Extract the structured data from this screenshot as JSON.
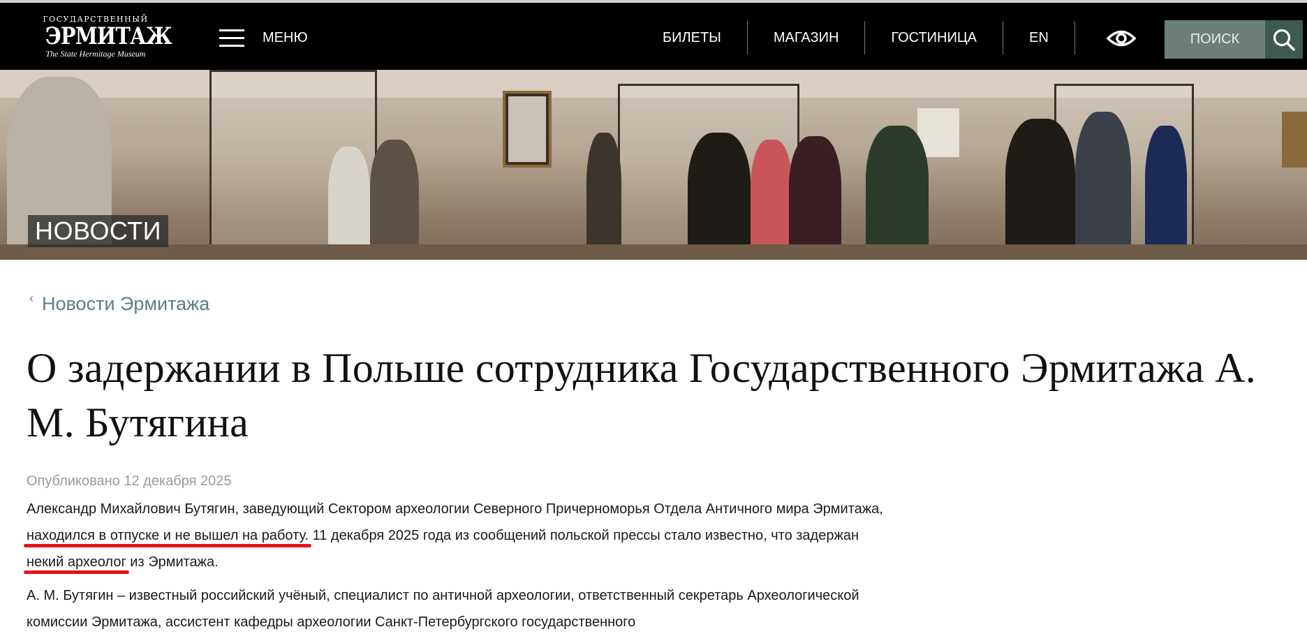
{
  "header": {
    "logo_line1": "ГОСУДАРСТВЕННЫЙ",
    "logo_line2": "ЭРМИТАЖ",
    "logo_line3": "The State Hermitage Museum",
    "menu_label": "МЕНЮ",
    "nav": [
      {
        "label": "БИЛЕТЫ"
      },
      {
        "label": "МАГАЗИН"
      },
      {
        "label": "ГОСТИНИЦА"
      },
      {
        "label": "EN"
      }
    ],
    "search_label": "ПОИСК",
    "icons": [
      "menu-icon",
      "eye-icon",
      "search-icon"
    ]
  },
  "banner": {
    "label": "НОВОСТИ"
  },
  "breadcrumb": {
    "label": "Новости Эрмитажа"
  },
  "article": {
    "title": "О задержании в Польше сотрудника Государственного Эрмитажа А. М. Бутягина",
    "date": "Опубликовано 12 декабря 2025",
    "p1": {
      "part1": "Александр Михайлович Бутягин, заведующий Сектором археологии Северного Причерноморья Отдела Античного мира Эрмитажа,",
      "highlight1": "находился в отпуске и не вышел на работу.",
      "part2": "11 декабря 2025 года из сообщений польской прессы стало известно, что задержан",
      "highlight2": "некий археолог",
      "part3": "из Эрмитажа."
    },
    "p2": "А. М. Бутягин – известный российский учёный, специалист по античной археологии, ответственный секретарь Археологической комиссии Эрмитажа, ассистент кафедры археологии Санкт-Петербургского государственного"
  },
  "colors": {
    "header_bg": "#000000",
    "search_bg": "#6e7f7b",
    "search_button_bg": "#3d5a4f",
    "breadcrumb": "#5b7c8f",
    "date": "#9a9a9a",
    "underline": "#e3141b"
  }
}
